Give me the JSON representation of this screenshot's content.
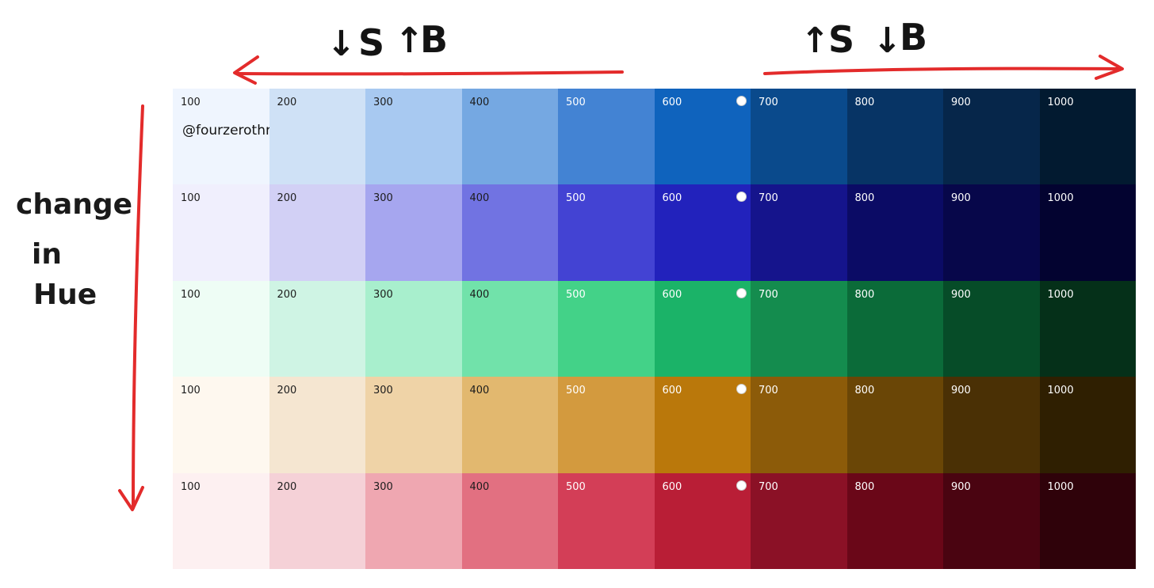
{
  "annotations": {
    "left_group": {
      "arrow1": "↓",
      "letter1": "S",
      "arrow2": "↑",
      "letter2": "B"
    },
    "right_group": {
      "arrow1": "↑",
      "letter1": "S",
      "arrow2": "↓",
      "letter2": "B"
    },
    "vertical_label_lines": [
      "change",
      "in",
      "Hue"
    ],
    "arrow_color": "#e32b2b"
  },
  "watermark": "@fourzerothree",
  "steps": [
    "100",
    "200",
    "300",
    "400",
    "500",
    "600",
    "700",
    "800",
    "900",
    "1000"
  ],
  "base_step_index": 5,
  "palettes": [
    {
      "hue": "blue",
      "colors": [
        "#eff5fe",
        "#cfe1f6",
        "#a8c9f1",
        "#75a8e2",
        "#4383d3",
        "#0f63bd",
        "#0a4a8c",
        "#073465",
        "#06264a",
        "#021a30"
      ]
    },
    {
      "hue": "indigo",
      "colors": [
        "#f0effd",
        "#d2d0f5",
        "#a6a6ef",
        "#7173e2",
        "#4343d3",
        "#2222bc",
        "#15148c",
        "#0b0b65",
        "#07074a",
        "#030330"
      ]
    },
    {
      "hue": "green",
      "colors": [
        "#eefdf5",
        "#cff4e4",
        "#a8efcd",
        "#71e2aa",
        "#43d288",
        "#1bb368",
        "#148c4e",
        "#0b6b39",
        "#064c28",
        "#053019"
      ]
    },
    {
      "hue": "amber",
      "colors": [
        "#fef8ef",
        "#f5e6d1",
        "#efd3a7",
        "#e2b86f",
        "#d39a3e",
        "#ba780b",
        "#8c5b09",
        "#6a4606",
        "#4a3005",
        "#2f1f01"
      ]
    },
    {
      "hue": "red",
      "colors": [
        "#fdf0f1",
        "#f5d1d7",
        "#efa7b1",
        "#e27081",
        "#d33e57",
        "#b91e36",
        "#8b1126",
        "#6a0718",
        "#4a0411",
        "#2f020a"
      ]
    }
  ]
}
